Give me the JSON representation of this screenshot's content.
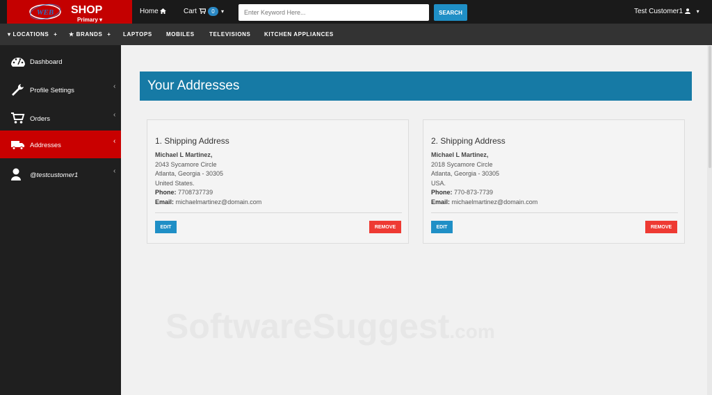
{
  "brand": {
    "name": "SHOP",
    "subtitle": "Primary",
    "color": "#c40000",
    "badge_text": "WEB"
  },
  "topnav": {
    "home_label": "Home",
    "cart_label": "Cart",
    "cart_count": "0",
    "search_placeholder": "Enter Keyword Here...",
    "search_button": "SEARCH",
    "user_name": "Test Customer1"
  },
  "categories": [
    "LOCATIONS",
    "BRANDS",
    "LAPTOPS",
    "MOBILES",
    "TELEVISIONS",
    "KITCHEN APPLIANCES"
  ],
  "sidebar": {
    "items": [
      {
        "label": "Dashboard",
        "icon": "dashboard-icon"
      },
      {
        "label": "Profile Settings",
        "icon": "wrench-icon"
      },
      {
        "label": "Orders",
        "icon": "cart-icon"
      },
      {
        "label": "Addresses",
        "icon": "truck-icon",
        "active": true
      },
      {
        "label": "@testcustomer1",
        "icon": "user-icon"
      }
    ]
  },
  "main": {
    "title": "Your Addresses",
    "addresses": [
      {
        "title": "1. Shipping Address",
        "name": "Michael L Martinez,",
        "street": "2043 Sycamore Circle",
        "city_line": "Atlanta, Georgia - 30305",
        "country": "United States.",
        "phone_label": "Phone:",
        "phone": "7708737739",
        "email_label": "Email:",
        "email": "michaelmartinez@domain.com",
        "edit_label": "EDIT",
        "remove_label": "REMOVE"
      },
      {
        "title": "2. Shipping Address",
        "name": "Michael L Martinez,",
        "street": "2018 Sycamore Circle",
        "city_line": "Atlanta, Georgia - 30305",
        "country": "USA.",
        "phone_label": "Phone:",
        "phone": "770-873-7739",
        "email_label": "Email:",
        "email": "michaelmartinez@domain.com",
        "edit_label": "EDIT",
        "remove_label": "REMOVE"
      }
    ]
  },
  "watermark": {
    "text": "SoftwareSuggest",
    "suffix": ".com"
  },
  "colors": {
    "header_blue": "#167aa5",
    "button_blue": "#1f8fc6",
    "remove_red": "#ee3a33",
    "active_red": "#c90000"
  }
}
